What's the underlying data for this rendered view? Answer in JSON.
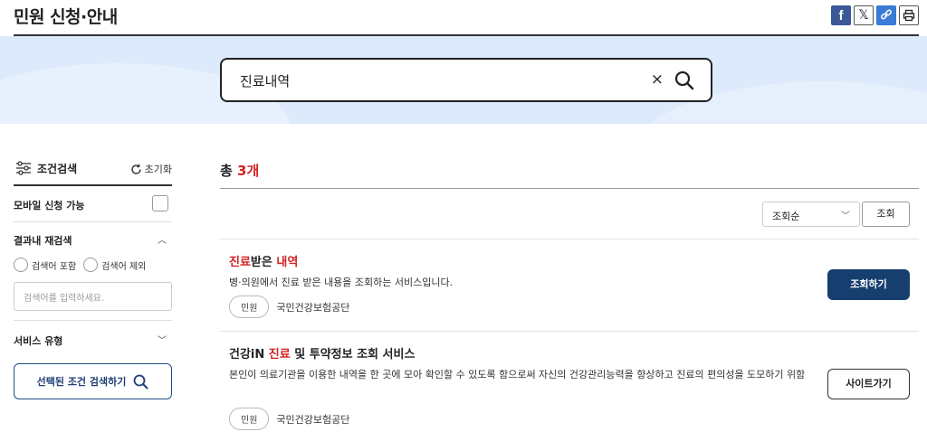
{
  "header": {
    "title": "민원 신청·안내",
    "share": [
      {
        "icon": "facebook-icon"
      },
      {
        "icon": "x-twitter-icon"
      },
      {
        "icon": "link-icon"
      },
      {
        "icon": "print-icon"
      }
    ]
  },
  "search": {
    "value": "진료내역",
    "clear_glyph": "×"
  },
  "sidebar": {
    "title": "조건검색",
    "reset_label": "초기화",
    "mobile_label": "모바일 신청 가능",
    "refine_label": "결과내 재검색",
    "radio_include": "검색어 포함",
    "radio_exclude": "검색어 제외",
    "keyword_placeholder": "검색어를 입력하세요.",
    "service_type_label": "서비스 유형",
    "search_selected_label": "선택된 조건 검색하기"
  },
  "results": {
    "total_prefix": "총 ",
    "total_count": "3개",
    "sort_selected": "조회순",
    "sort_button": "조회",
    "items": [
      {
        "title_parts": [
          "진료",
          "받은 ",
          "내역"
        ],
        "description": "병·의원에서 진료 받은 내용을 조회하는 서비스입니다.",
        "tag": "민원",
        "org": "국민건강보험공단",
        "button": "조회하기"
      },
      {
        "title_parts": [
          "건강iN ",
          "진료",
          " 및 투약정보 조회 서비스"
        ],
        "description": "본인이 의료기관을 이용한 내역을 한 곳에 모아 확인할 수 있도록 함으로써 자신의 건강관리능력을 향상하고 진료의 편의성을 도모하기 위함",
        "tag": "민원",
        "org": "국민건강보험공단",
        "button": "사이트가기"
      }
    ]
  },
  "colors": {
    "accent_red": "#d32222",
    "primary_navy": "#163e6f",
    "banner_bg": "#dceafb"
  }
}
